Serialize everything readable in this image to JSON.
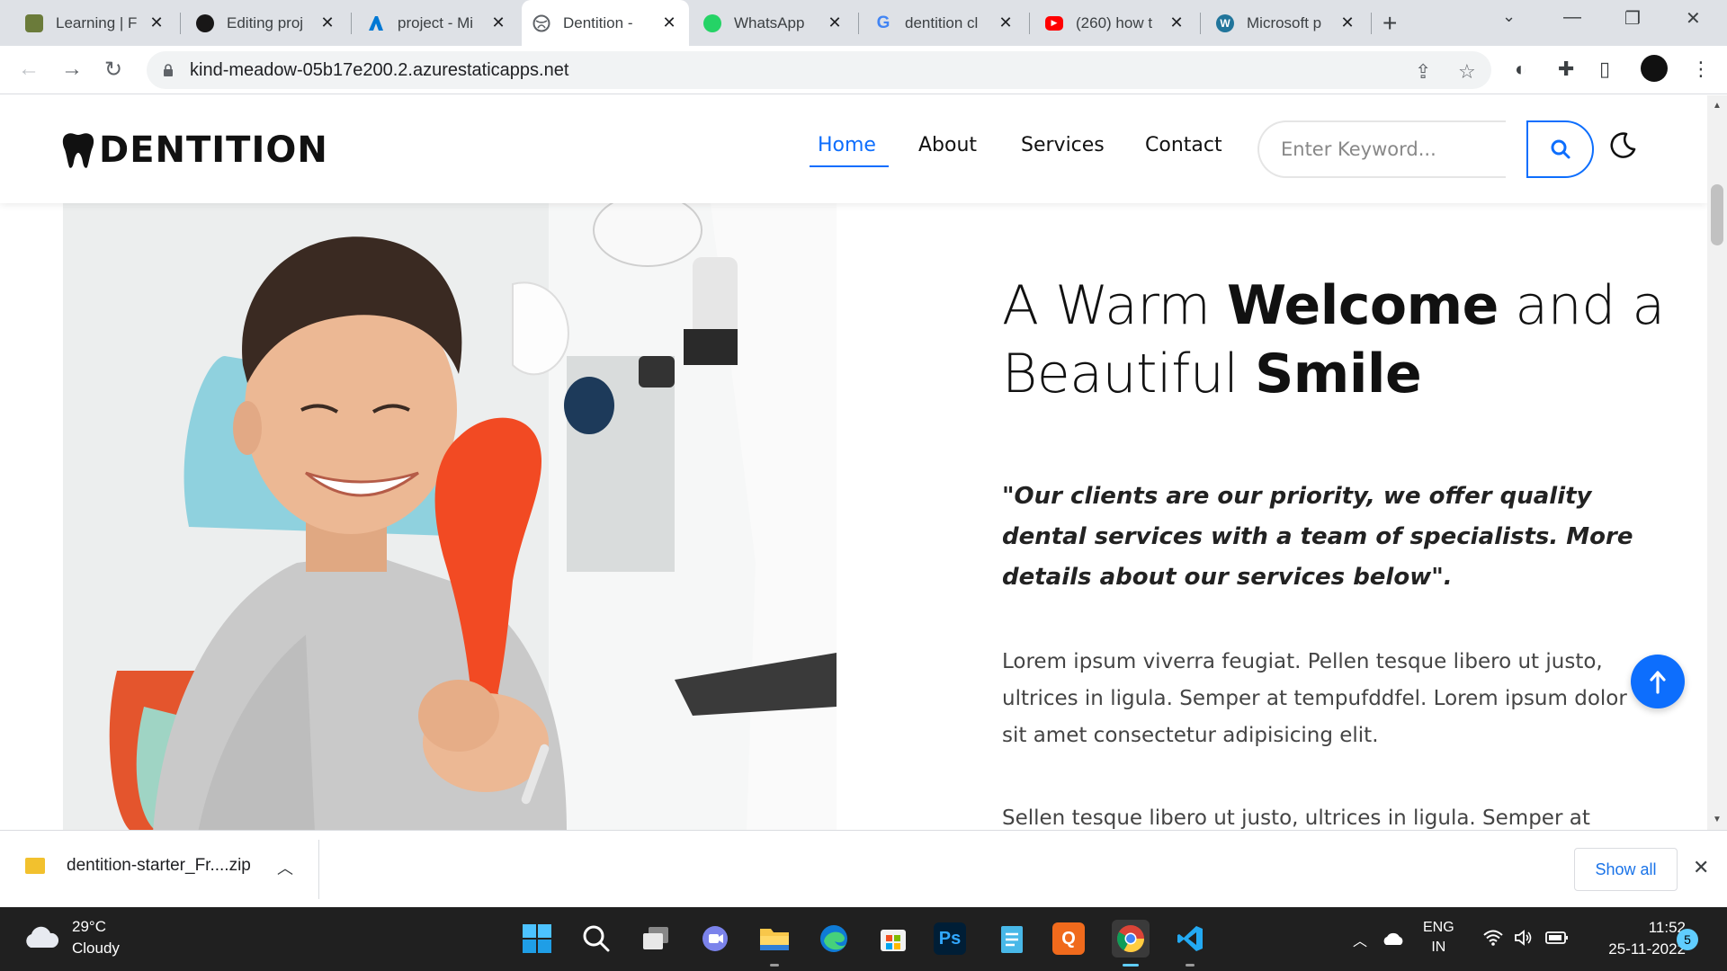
{
  "browser": {
    "tabs": [
      {
        "title": "Learning | F",
        "favicon": "learning-favicon",
        "color": "#6b7b3a"
      },
      {
        "title": "Editing proj",
        "favicon": "github-icon",
        "color": "#181717"
      },
      {
        "title": "project - Mi",
        "favicon": "azure-devops-icon",
        "color": "#0078d4"
      },
      {
        "title": "Dentition -",
        "favicon": "globe-icon",
        "color": "#5f6368",
        "active": true
      },
      {
        "title": "WhatsApp",
        "favicon": "whatsapp-icon",
        "color": "#25d366"
      },
      {
        "title": "dentition cl",
        "favicon": "google-icon",
        "color": "#4285f4"
      },
      {
        "title": "(260) how t",
        "favicon": "youtube-icon",
        "color": "#ff0000"
      },
      {
        "title": "Microsoft p",
        "favicon": "wordpress-icon",
        "color": "#21759b"
      }
    ],
    "url": "kind-meadow-05b17e200.2.azurestaticapps.net"
  },
  "site": {
    "logo_text": "DENTITION",
    "nav": [
      {
        "label": "Home",
        "active": true
      },
      {
        "label": "About"
      },
      {
        "label": "Services"
      },
      {
        "label": "Contact"
      }
    ],
    "search_placeholder": "Enter Keyword...",
    "accent": "#0d6efd",
    "hero": {
      "title_1": "A Warm ",
      "title_bold_1": "Welcome",
      "title_2": " and a Beautiful ",
      "title_bold_2": "Smile",
      "quote": "\"Our clients are our priority, we offer quality dental services with a team of specialists. More details about our services below\".",
      "paragraph_1": "Lorem ipsum viverra feugiat. Pellen tesque libero ut justo, ultrices in ligula. Semper at tempufddfel. Lorem ipsum dolor sit amet consectetur adipisicing elit.",
      "paragraph_2": "Sellen tesque libero ut justo, ultrices in ligula. Semper at"
    }
  },
  "download_bar": {
    "filename": "dentition-starter_Fr....zip",
    "show_all": "Show all"
  },
  "taskbar": {
    "weather_temp": "29°C",
    "weather_desc": "Cloudy",
    "lang_1": "ENG",
    "lang_2": "IN",
    "time": "11:52",
    "date": "25-11-2022",
    "notifications": "5",
    "apps": [
      {
        "name": "start-icon"
      },
      {
        "name": "search-icon"
      },
      {
        "name": "task-view-icon"
      },
      {
        "name": "teams-chat-icon"
      },
      {
        "name": "file-explorer-icon",
        "running": true
      },
      {
        "name": "edge-icon"
      },
      {
        "name": "store-icon"
      },
      {
        "name": "photoshop-icon",
        "label": "Ps"
      },
      {
        "name": "notepad-icon"
      },
      {
        "name": "quick-heal-icon",
        "label": "Q"
      },
      {
        "name": "chrome-icon",
        "active": true
      },
      {
        "name": "vscode-icon",
        "running": true
      }
    ]
  }
}
